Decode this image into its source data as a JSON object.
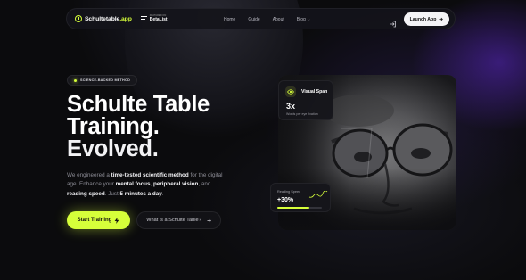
{
  "nav": {
    "logo_text": "Schultetable",
    "logo_tld": ".app",
    "betalist_small": "FEATURED ON",
    "betalist_big": "BetaList",
    "links": [
      "Home",
      "Guide",
      "About",
      "Blog"
    ],
    "launch_label": "Launch App"
  },
  "hero": {
    "badge": "SCIENCE-BACKED METHOD",
    "title_line1": "Schulte Table",
    "title_line2": "Training.",
    "title_line3": "Evolved.",
    "desc": {
      "t1": "We engineered a ",
      "b1": "time-tested scientific method",
      "t2": " for the digital age. Enhance your ",
      "b2": "mental focus",
      "t3": ", ",
      "b3": "peripheral vision",
      "t4": ", and ",
      "b4": "reading speed",
      "t5": ". Just ",
      "b5": "5 minutes a day",
      "t6": "."
    },
    "cta_label": "Start Training",
    "secondary_label": "What is a Schulte Table?"
  },
  "visual_span": {
    "title": "Visual Span",
    "value": "3x",
    "sub": "Words per eye fixation"
  },
  "reading_speed": {
    "label": "Reading Speed",
    "value": "+30%",
    "progress_fraction": 0.72
  },
  "colors": {
    "accent": "#d6ff3a",
    "background": "#0b0b0d",
    "glow": "#5c28c8"
  },
  "icons": [
    "logo-target-icon",
    "betalist-icon",
    "chevron-down-icon",
    "login-icon",
    "arrow-right-icon",
    "bolt-icon",
    "eye-icon",
    "sparkline-icon"
  ]
}
